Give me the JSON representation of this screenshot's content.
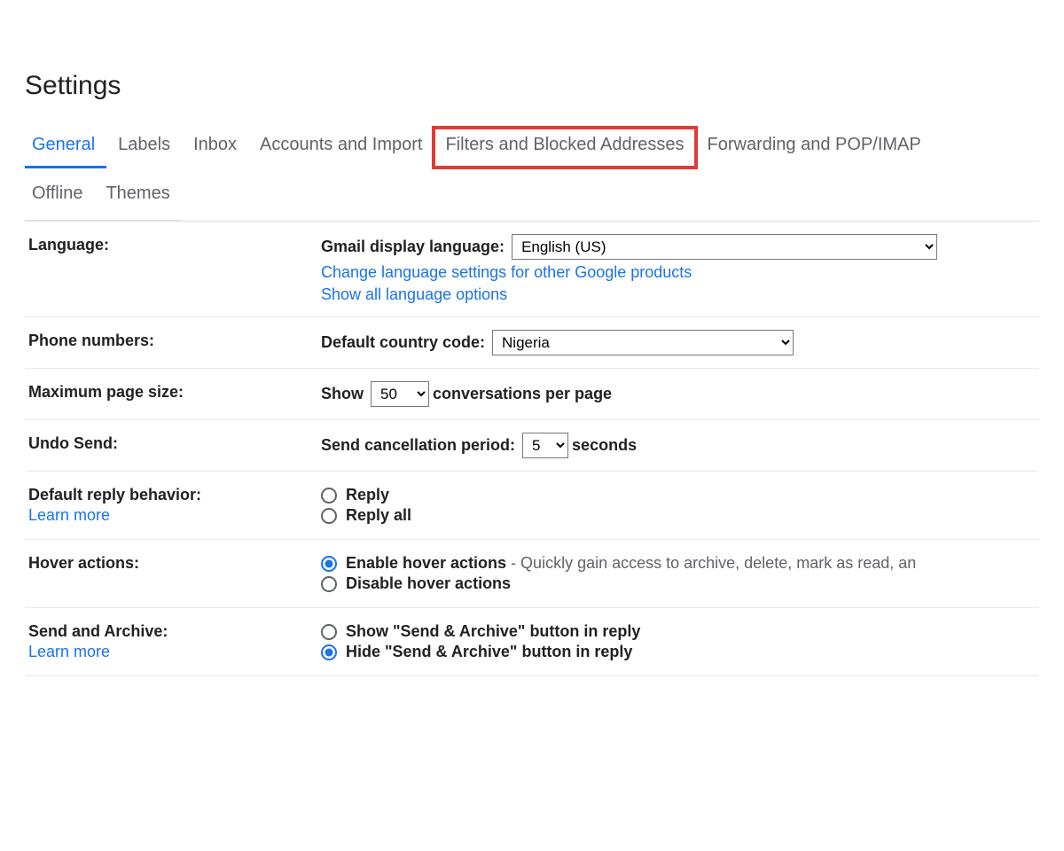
{
  "title": "Settings",
  "tabs_row1": [
    {
      "label": "General",
      "active": true,
      "highlighted": false,
      "name": "tab-general"
    },
    {
      "label": "Labels",
      "active": false,
      "highlighted": false,
      "name": "tab-labels"
    },
    {
      "label": "Inbox",
      "active": false,
      "highlighted": false,
      "name": "tab-inbox"
    },
    {
      "label": "Accounts and Import",
      "active": false,
      "highlighted": false,
      "name": "tab-accounts"
    },
    {
      "label": "Filters and Blocked Addresses",
      "active": false,
      "highlighted": true,
      "name": "tab-filters"
    },
    {
      "label": "Forwarding and POP/IMAP",
      "active": false,
      "highlighted": false,
      "name": "tab-forwarding"
    }
  ],
  "tabs_row2": [
    {
      "label": "Offline",
      "active": false,
      "name": "tab-offline"
    },
    {
      "label": "Themes",
      "active": false,
      "name": "tab-themes"
    }
  ],
  "language": {
    "label": "Language:",
    "display_label": "Gmail display language:",
    "selected": "English (US)",
    "change_link": "Change language settings for other Google products",
    "showall_link": "Show all language options"
  },
  "phone": {
    "label": "Phone numbers:",
    "prefix": "Default country code:",
    "selected": "Nigeria"
  },
  "pagesize": {
    "label": "Maximum page size:",
    "prefix": "Show",
    "selected": "50",
    "suffix": "conversations per page"
  },
  "undo": {
    "label": "Undo Send:",
    "prefix": "Send cancellation period:",
    "selected": "5",
    "suffix": "seconds"
  },
  "reply": {
    "label": "Default reply behavior:",
    "learn": "Learn more",
    "opt1": "Reply",
    "opt2": "Reply all"
  },
  "hover": {
    "label": "Hover actions:",
    "opt1": "Enable hover actions",
    "opt1_desc": " - Quickly gain access to archive, delete, mark as read, an",
    "opt2": "Disable hover actions"
  },
  "sendarchive": {
    "label": "Send and Archive:",
    "learn": "Learn more",
    "opt1": "Show \"Send & Archive\" button in reply",
    "opt2": "Hide \"Send & Archive\" button in reply"
  }
}
